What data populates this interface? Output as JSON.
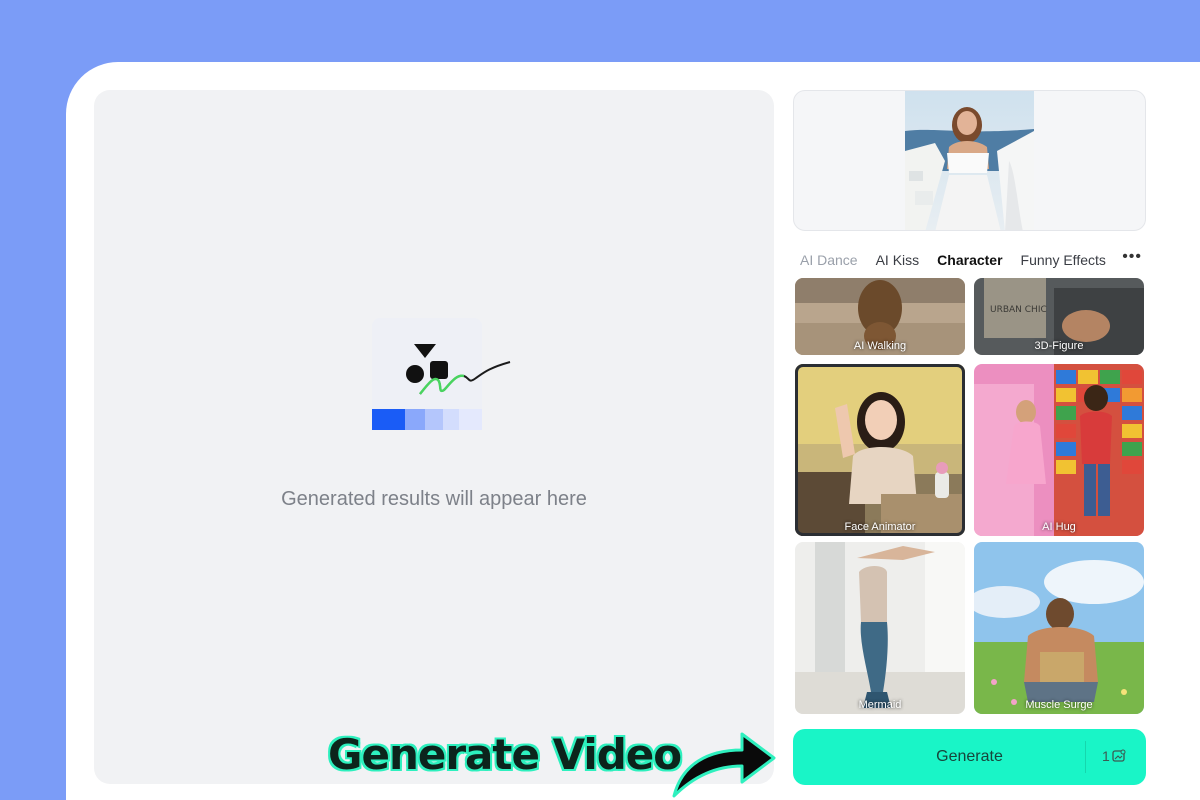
{
  "results": {
    "placeholder_text": "Generated results will appear here",
    "illustration_icon": "shapes-pen-icon"
  },
  "upload": {
    "image_icon": "portrait-photo"
  },
  "tabs": [
    {
      "label": "AI Dance"
    },
    {
      "label": "AI Kiss"
    },
    {
      "label": "Character"
    },
    {
      "label": "Funny Effects"
    }
  ],
  "tabs_active": "Character",
  "tabs_more_icon": "more-horizontal-icon",
  "tiles": [
    {
      "label": "AI Walking"
    },
    {
      "label": "3D-Figure"
    },
    {
      "label": "Face Animator"
    },
    {
      "label": "AI Hug"
    },
    {
      "label": "Mermaid"
    },
    {
      "label": "Muscle Surge"
    }
  ],
  "selected_tile": "Face Animator",
  "generate": {
    "label": "Generate",
    "credit": "1",
    "credit_icon": "coin-image-icon"
  },
  "overlay": {
    "caption": "Generate Video",
    "arrow_icon": "curved-arrow-icon"
  },
  "colors": {
    "background": "#7b9cf7",
    "accent": "#19f5c7",
    "caption_outline": "#2ef0be"
  }
}
